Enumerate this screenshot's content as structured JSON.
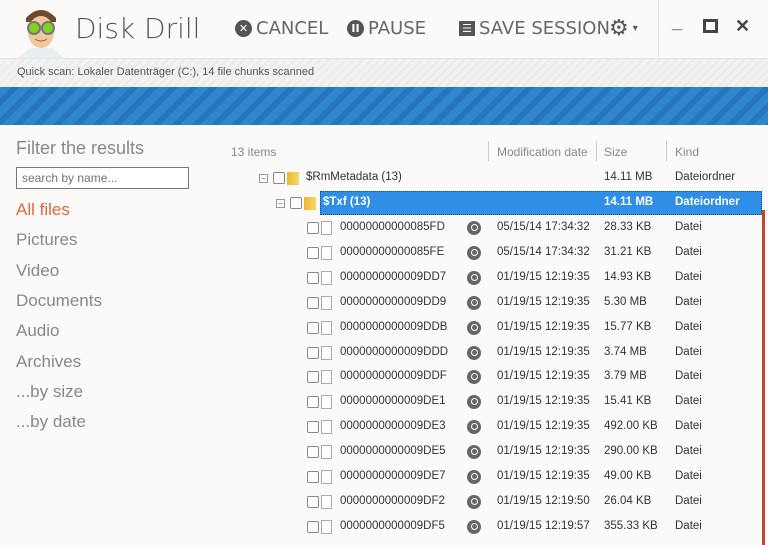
{
  "app": {
    "title": "Disk Drill",
    "cancel": "CANCEL",
    "pause": "PAUSE",
    "save_session": "SAVE SESSION",
    "minimize": "_",
    "maximize": "☐",
    "close": "✕"
  },
  "status": "Quick scan: Lokaler Datenträger (C:), 14 file chunks scanned",
  "progress": {
    "state": "indeterminate",
    "color": "#2f86cc"
  },
  "sidebar": {
    "title": "Filter the results",
    "search_placeholder": "search by name...",
    "items": [
      {
        "label": "All files",
        "active": true
      },
      {
        "label": "Pictures"
      },
      {
        "label": "Video"
      },
      {
        "label": "Documents"
      },
      {
        "label": "Audio"
      },
      {
        "label": "Archives"
      },
      {
        "label": "...by size"
      },
      {
        "label": "...by date"
      }
    ]
  },
  "table": {
    "count": "13 items",
    "columns": [
      "Modification date",
      "Size",
      "Kind"
    ],
    "folders": [
      {
        "name": "$RmMetadata (13)",
        "size": "14.11 MB",
        "kind": "Dateiordner"
      },
      {
        "name": "$Txf (13)",
        "size": "14.11 MB",
        "kind": "Dateiordner",
        "selected": true
      }
    ],
    "files": [
      {
        "name": "00000000000085FD",
        "date": "05/15/14 17:34:32",
        "size": "28.33 KB",
        "kind": "Datei"
      },
      {
        "name": "00000000000085FE",
        "date": "05/15/14 17:34:32",
        "size": "31.21 KB",
        "kind": "Datei"
      },
      {
        "name": "0000000000009DD7",
        "date": "01/19/15 12:19:35",
        "size": "14.93 KB",
        "kind": "Datei"
      },
      {
        "name": "0000000000009DD9",
        "date": "01/19/15 12:19:35",
        "size": "5.30 MB",
        "kind": "Datei"
      },
      {
        "name": "0000000000009DDB",
        "date": "01/19/15 12:19:35",
        "size": "15.77 KB",
        "kind": "Datei"
      },
      {
        "name": "0000000000009DDD",
        "date": "01/19/15 12:19:35",
        "size": "3.74 MB",
        "kind": "Datei"
      },
      {
        "name": "0000000000009DDF",
        "date": "01/19/15 12:19:35",
        "size": "3.79 MB",
        "kind": "Datei"
      },
      {
        "name": "0000000000009DE1",
        "date": "01/19/15 12:19:35",
        "size": "15.41 KB",
        "kind": "Datei"
      },
      {
        "name": "0000000000009DE3",
        "date": "01/19/15 12:19:35",
        "size": "492.00 KB",
        "kind": "Datei"
      },
      {
        "name": "0000000000009DE5",
        "date": "01/19/15 12:19:35",
        "size": "290.00 KB",
        "kind": "Datei"
      },
      {
        "name": "0000000000009DE7",
        "date": "01/19/15 12:19:35",
        "size": "49.00 KB",
        "kind": "Datei"
      },
      {
        "name": "0000000000009DF2",
        "date": "01/19/15 12:19:50",
        "size": "26.04 KB",
        "kind": "Datei"
      },
      {
        "name": "0000000000009DF5",
        "date": "01/19/15 12:19:57",
        "size": "355.33 KB",
        "kind": "Datei"
      }
    ]
  }
}
